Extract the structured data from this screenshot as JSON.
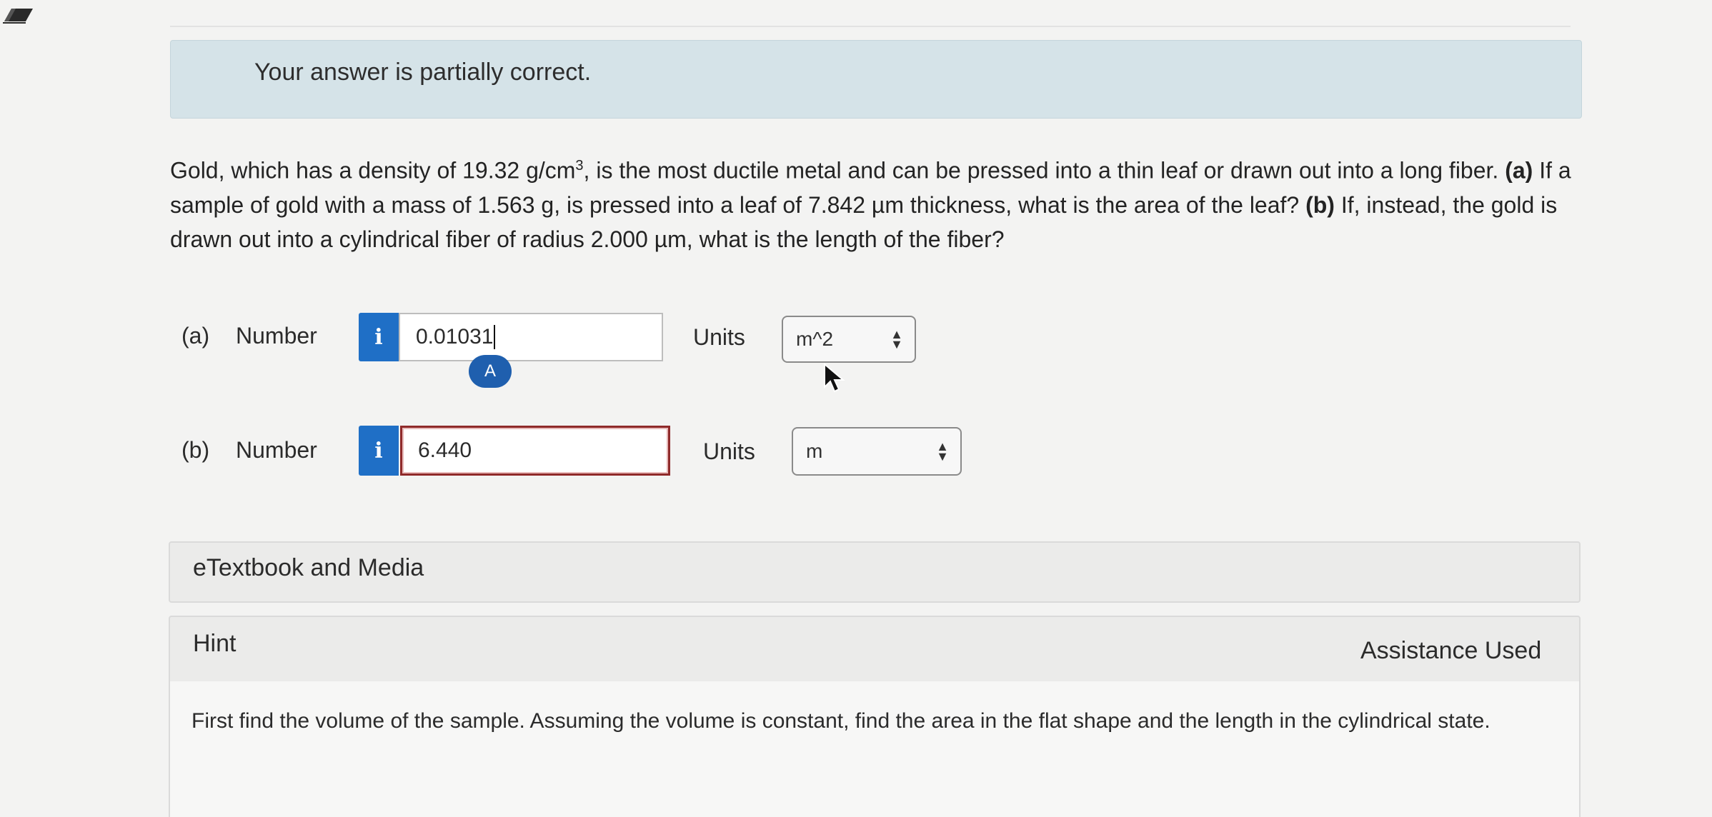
{
  "feedback": {
    "icon": "pencil-icon",
    "message": "Your answer is partially correct.",
    "background": "#d5e3e8"
  },
  "question": {
    "text_1": "Gold, which has a density of 19.32 g/cm",
    "superscript": "3",
    "text_2": ", is the most ductile metal and can be pressed into a thin leaf or drawn out into a long fiber. ",
    "part_a_marker": "(a)",
    "text_3": " If a sample of gold with a mass of 1.563 g, is pressed into a leaf of 7.842 µm thickness, what is the area of the leaf? ",
    "part_b_marker": "(b)",
    "text_4": " If, instead, the gold is drawn out into a cylindrical fiber of radius 2.000 µm, what is the length of the fiber?"
  },
  "answers": {
    "part_a": {
      "part_label": "(a)",
      "number_label": "Number",
      "info_icon_text": "i",
      "value": "0.01031",
      "badge": "A",
      "units_label": "Units",
      "units_value": "m^2"
    },
    "part_b": {
      "part_label": "(b)",
      "number_label": "Number",
      "info_icon_text": "i",
      "value": "6.440",
      "units_label": "Units",
      "units_value": "m"
    }
  },
  "etextbook": {
    "title": "eTextbook and Media"
  },
  "hint": {
    "title": "Hint",
    "status": "Assistance Used",
    "text": "First find the volume of the sample. Assuming the volume is constant, find the area in the flat shape and the length in the cylindrical state."
  },
  "colors": {
    "info_button": "#1f6fc6",
    "incorrect_border": "#8f2a2a",
    "badge": "#1f5fae"
  }
}
